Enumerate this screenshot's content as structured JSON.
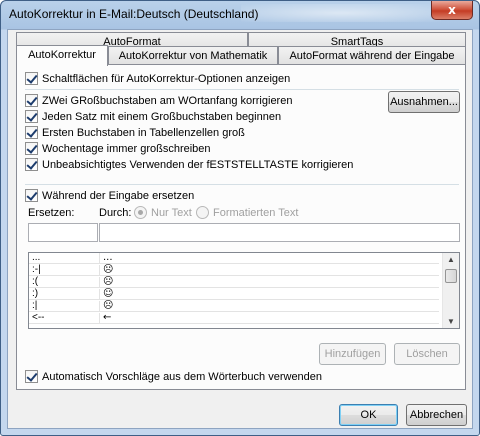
{
  "window": {
    "title": "AutoKorrektur in E-Mail:Deutsch (Deutschland)",
    "close_glyph": "x"
  },
  "tabs": {
    "row1": [
      "AutoFormat",
      "SmartTags"
    ],
    "row2": [
      "AutoKorrektur",
      "AutoKorrektur von Mathematik",
      "AutoFormat während der Eingabe"
    ],
    "active": "AutoKorrektur"
  },
  "options": {
    "show_buttons": {
      "label": "Schaltflächen für AutoKorrektur-Optionen anzeigen",
      "checked": true
    },
    "two_caps": {
      "label": "ZWei GRoßbuchstaben am WOrtanfang korrigieren",
      "checked": true
    },
    "sentence_cap": {
      "label": "Jeden Satz mit einem Großbuchstaben beginnen",
      "checked": true
    },
    "table_cap": {
      "label": "Ersten Buchstaben in Tabellenzellen groß",
      "checked": true
    },
    "weekdays": {
      "label": "Wochentage immer großschreiben",
      "checked": true
    },
    "capslock": {
      "label": "Unbeabsichtigtes Verwenden der fESTSTELLTASTE korrigieren",
      "checked": true
    },
    "exceptions_button": "Ausnahmen..."
  },
  "replace": {
    "label": "Während der Eingabe ersetzen",
    "checked": true,
    "replace_label": "Ersetzen:",
    "with_label": "Durch:",
    "radio_plain": "Nur Text",
    "radio_formatted": "Formatierten Text",
    "replace_value": "",
    "with_value": "",
    "entries": [
      {
        "from": "...",
        "to": "..."
      },
      {
        "from": ":-|",
        "to": "☹"
      },
      {
        "from": ":(",
        "to": "☹"
      },
      {
        "from": ":)",
        "to": "☺"
      },
      {
        "from": ":|",
        "to": "☹"
      },
      {
        "from": "<--",
        "to": "←"
      }
    ],
    "add_button": "Hinzufügen",
    "delete_button": "Löschen"
  },
  "suggestions": {
    "label": "Automatisch Vorschläge aus dem Wörterbuch verwenden",
    "checked": true
  },
  "footer": {
    "ok": "OK",
    "cancel": "Abbrechen"
  }
}
